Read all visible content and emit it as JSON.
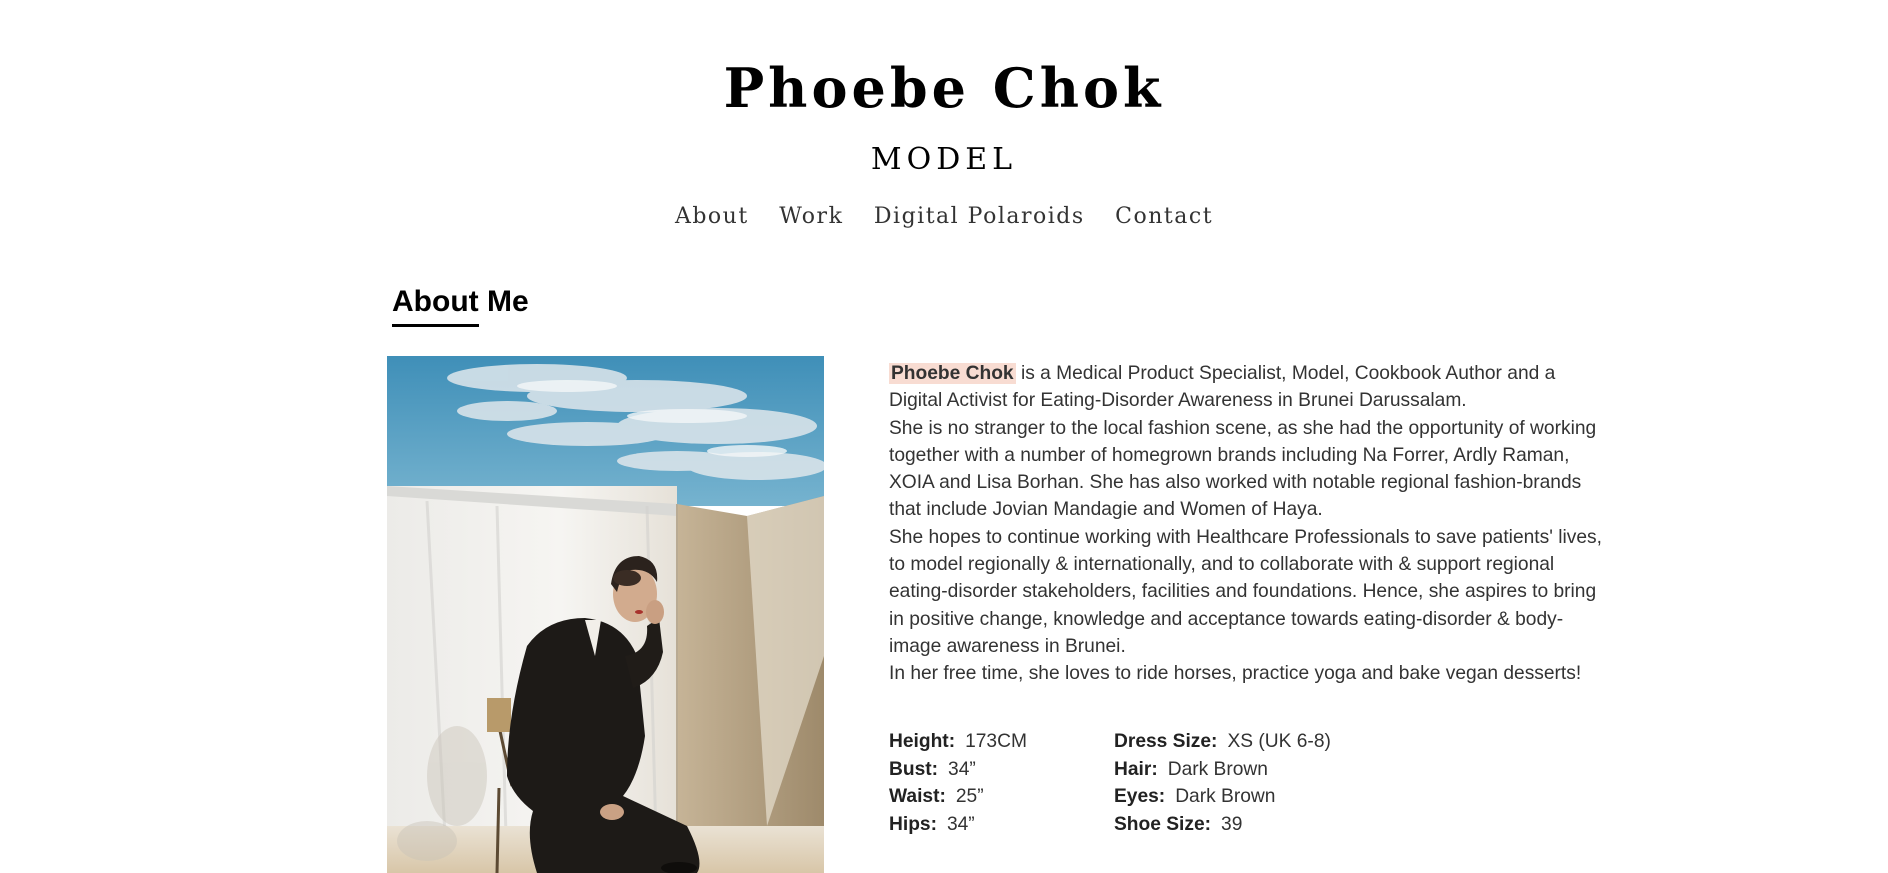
{
  "site": {
    "title": "Phoebe Chok",
    "subtitle": "MODEL"
  },
  "nav": {
    "items": [
      {
        "label": "About"
      },
      {
        "label": "Work"
      },
      {
        "label": "Digital Polaroids"
      },
      {
        "label": "Contact"
      }
    ]
  },
  "about": {
    "heading": "About Me",
    "bio": {
      "name": "Phoebe Chok",
      "p1_rest": " is a Medical Product Specialist, Model, Cookbook Author and a Digital Activist for Eating-Disorder Awareness in Brunei Darussalam.",
      "p2": "She is no stranger to the local fashion scene, as she had the opportunity of working together with a number of homegrown brands including Na Forrer, Ardly Raman, XOIA and Lisa Borhan. She has also worked with notable regional fashion-brands that include Jovian Mandagie and Women of Haya.",
      "p3": "She hopes to continue working with Healthcare Professionals to save patients' lives, to model regionally & internationally, and to collaborate with & support regional eating-disorder stakeholders, facilities and foundations. Hence, she aspires to bring in positive change, knowledge and acceptance towards eating-disorder & body-image awareness in Brunei.",
      "p4": "In her free time, she loves to ride horses, practice yoga and bake vegan desserts!"
    },
    "stats_left": [
      {
        "label": "Height:",
        "value": "173CM"
      },
      {
        "label": "Bust:",
        "value": "34”"
      },
      {
        "label": "Waist:",
        "value": "25”"
      },
      {
        "label": "Hips:",
        "value": "34”"
      }
    ],
    "stats_right": [
      {
        "label": "Dress Size:",
        "value": "XS (UK 6-8)"
      },
      {
        "label": "Hair:",
        "value": "Dark Brown"
      },
      {
        "label": "Eyes:",
        "value": "Dark Brown"
      },
      {
        "label": "Shoe Size:",
        "value": "39"
      }
    ]
  }
}
